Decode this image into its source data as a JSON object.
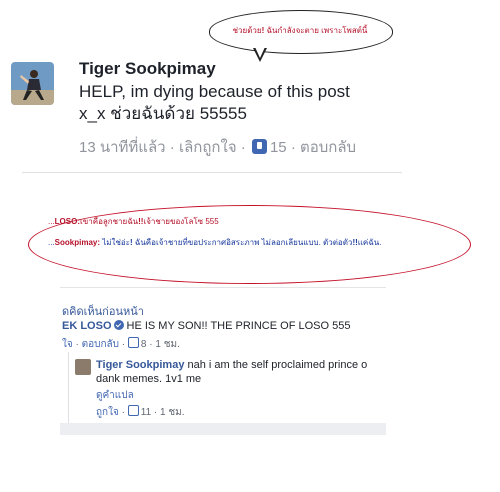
{
  "bubble": {
    "text_a": "ช่วยด้วย",
    "text_bang": "!",
    "text_b": " ฉันกำลังจะตาย เพราะโพสต์นี้"
  },
  "post": {
    "author": "Tiger Sookpimay",
    "line1": "HELP, im dying because of this post",
    "line2": "x_x ช่วยฉันด้วย 55555",
    "time": "13 นาทีที่แล้ว",
    "unlike": "เลิกถูกใจ",
    "like_count": "15",
    "reply": "ตอบกลับ",
    "sep": " · "
  },
  "annotation": {
    "line1_prefix": "...",
    "line1_name": "LOSO:",
    "line1_text": "เขาคือลูกชายฉัน",
    "line1_bang": "!!",
    "line1_rest": "เจ้าชายของโลโซ 555",
    "line2_prefix": "...",
    "line2_name": "Sookpimay:",
    "line2_text": " ไม่ใช่อ่ะ",
    "line2_bang": "!",
    "line2_rest": " ฉันคือเจ้าชายที่ขอประกาศอิสระภาพ ไม่ลอกเลียนแบบ. ตัวต่อตัว",
    "line2_bang2": "!!",
    "line2_end": "แค่ฉัน."
  },
  "comments": {
    "prev_link": "ดูความคิดเห็นก่อนหน้า",
    "prev_link_visible": "ดคิดเห็นก่อนหน้า",
    "c1_author": "EK LOSO",
    "c1_text": "HE IS MY SON!! THE PRINCE OF LOSO 555",
    "c1_like": "ใจ",
    "c1_reply": "ตอบกลับ",
    "c1_count": "8",
    "c1_time": "1 ชม.",
    "reply_author": "Tiger Sookpimay",
    "reply_text": "nah i am the self proclaimed prince of dank memes. 1v1 me",
    "reply_text_visible_1": "nah i am the self proclaimed prince o",
    "reply_text_visible_2": "dank memes. 1v1 me",
    "translate": "ดูคำแปล",
    "reply_like": "ถูกใจ",
    "reply_count": "11",
    "reply_time": "1 ชม."
  },
  "colors": {
    "annotation_red": "#c4122a",
    "facebook_blue": "#4267b2",
    "link_blue": "#365899"
  }
}
